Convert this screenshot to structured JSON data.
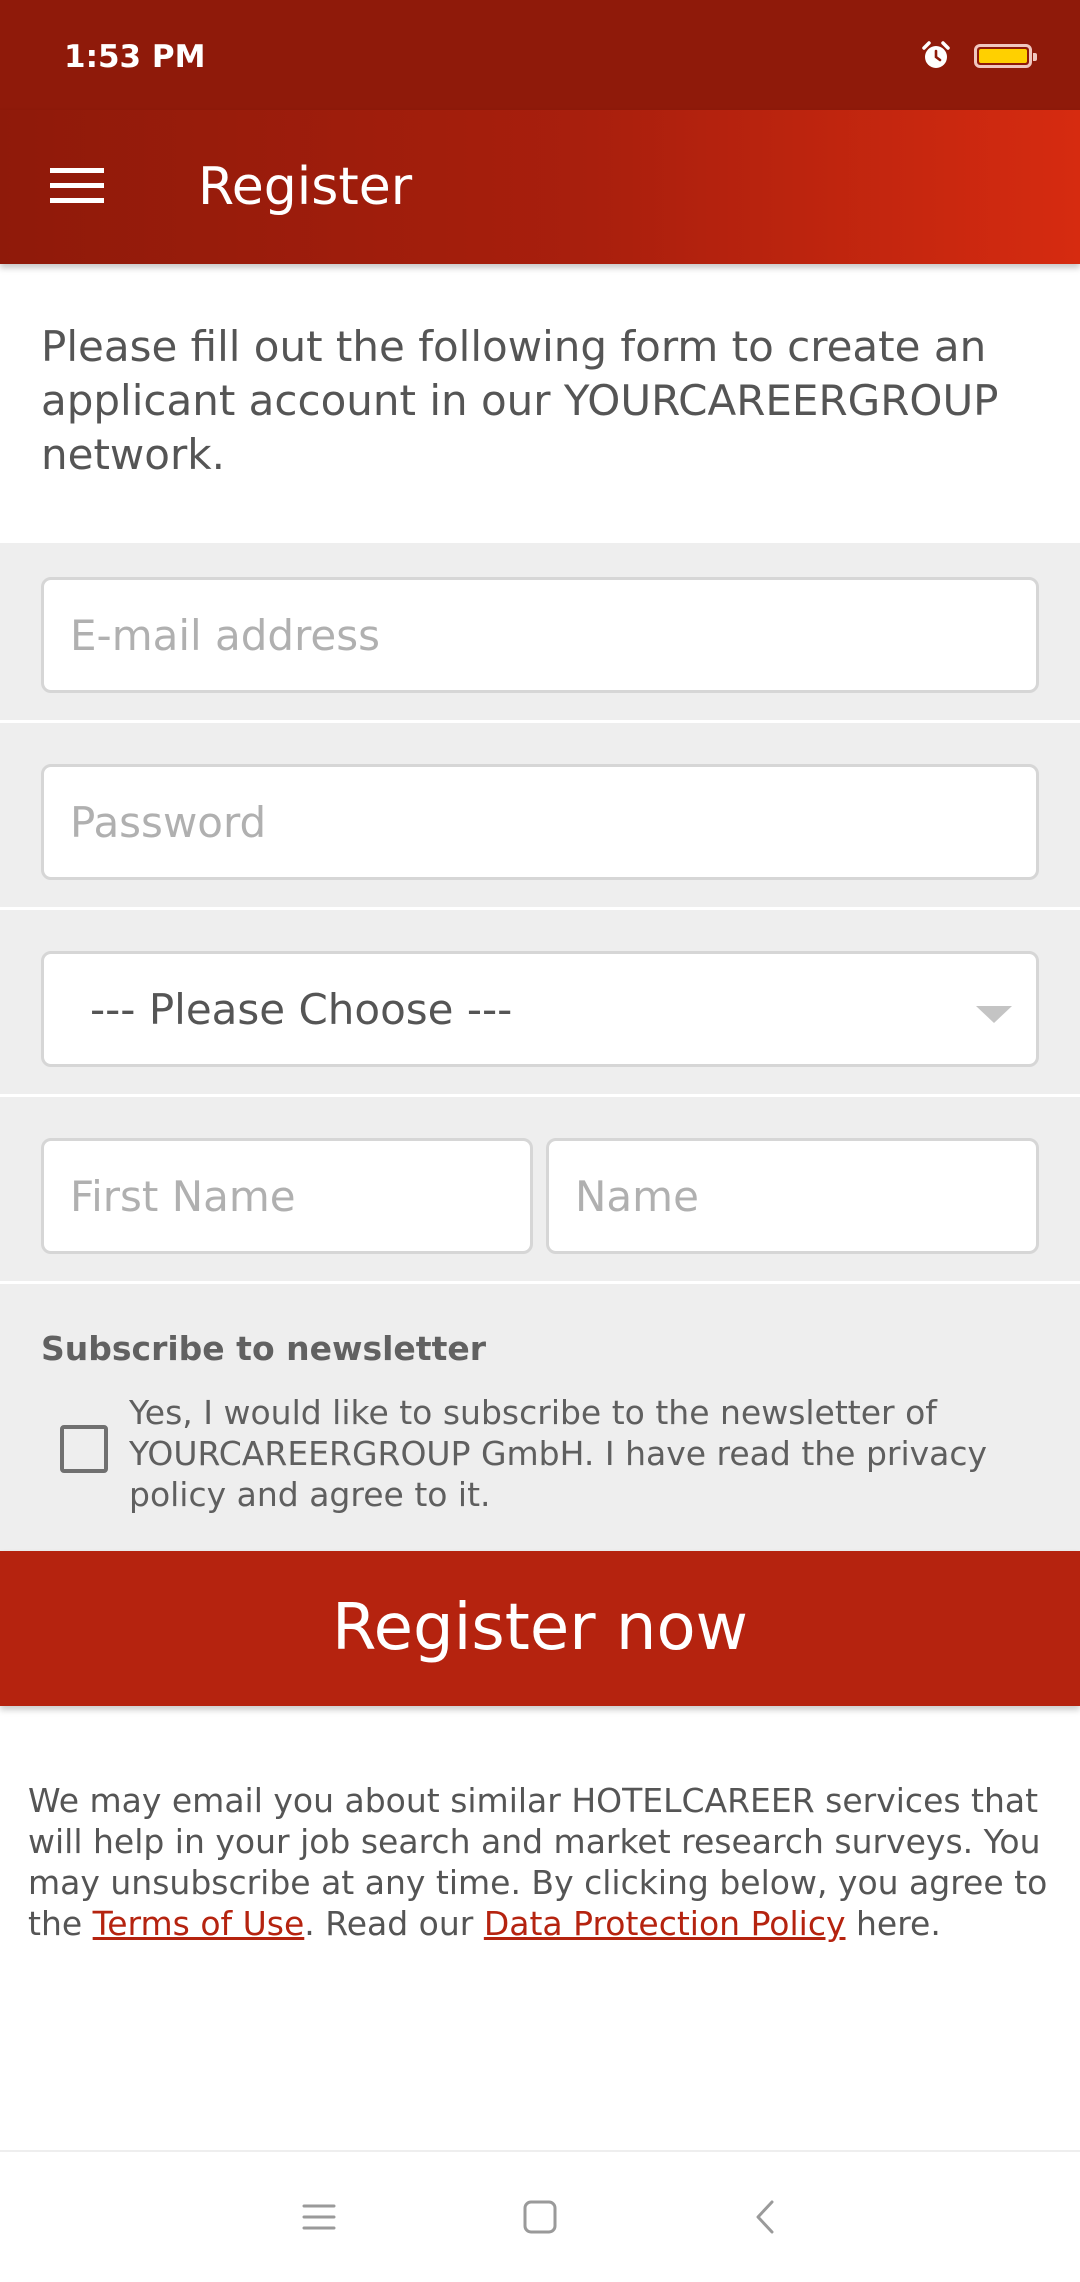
{
  "status_bar": {
    "time": "1:53 PM",
    "icons": [
      "alarm-icon",
      "battery-icon"
    ],
    "battery_color": "#ffd000"
  },
  "app_bar": {
    "title": "Register",
    "menu_icon": "hamburger-menu-icon",
    "background_colors": [
      "#8f1a0a",
      "#d62b10"
    ]
  },
  "intro": {
    "text": "Please fill out the following form to create an applicant account in our YOURCAREERGROUP network."
  },
  "form": {
    "email": {
      "value": "",
      "placeholder": "E-mail address"
    },
    "password": {
      "value": "",
      "placeholder": "Password"
    },
    "salutation": {
      "selected": "--- Please Choose ---"
    },
    "first_name": {
      "value": "",
      "placeholder": "First Name"
    },
    "last_name": {
      "value": "",
      "placeholder": "Name"
    },
    "newsletter": {
      "heading": "Subscribe to newsletter",
      "checked": false,
      "label": "Yes, I would like to subscribe to the newsletter of YOURCAREERGROUP GmbH. I have read the privacy policy and agree to it."
    }
  },
  "register_button": {
    "label": "Register now",
    "color": "#b5230f"
  },
  "legal": {
    "text_before": "We may email you about similar HOTELCAREER services that will help in your job search and market research surveys. You may unsubscribe at any time. By clicking below, you agree to the ",
    "terms_link": "Terms of Use",
    "text_middle": ". Read our ",
    "privacy_link": "Data Protection Policy",
    "text_after": " here.",
    "link_color": "#b5230f"
  },
  "nav_bar": {
    "icons": [
      "recents-icon",
      "home-icon",
      "back-icon"
    ]
  }
}
